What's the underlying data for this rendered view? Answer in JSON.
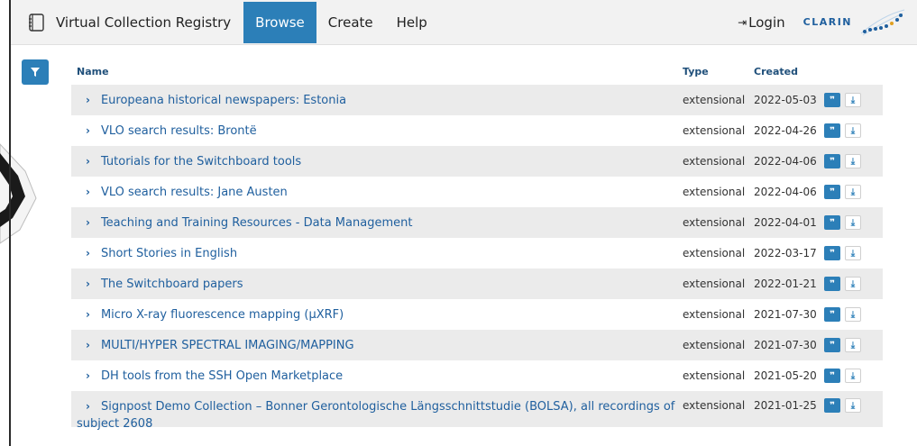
{
  "header": {
    "app_title": "Virtual Collection Registry",
    "nav": [
      {
        "label": "Browse",
        "active": true
      },
      {
        "label": "Create",
        "active": false
      },
      {
        "label": "Help",
        "active": false
      }
    ],
    "login_label": "Login",
    "brand_text": "CLARIN"
  },
  "colors": {
    "accent": "#2c7fb8",
    "link": "#1f5f9e",
    "row_alt": "#ebebeb"
  },
  "table": {
    "columns": {
      "name": "Name",
      "type": "Type",
      "created": "Created"
    },
    "rows": [
      {
        "name": "Europeana historical newspapers: Estonia",
        "type": "extensional",
        "created": "2022-05-03"
      },
      {
        "name": "VLO search results: Brontë",
        "type": "extensional",
        "created": "2022-04-26"
      },
      {
        "name": "Tutorials for the Switchboard tools",
        "type": "extensional",
        "created": "2022-04-06"
      },
      {
        "name": "VLO search results: Jane Austen",
        "type": "extensional",
        "created": "2022-04-06"
      },
      {
        "name": "Teaching and Training Resources - Data Management",
        "type": "extensional",
        "created": "2022-04-01"
      },
      {
        "name": "Short Stories in English",
        "type": "extensional",
        "created": "2022-03-17"
      },
      {
        "name": "The Switchboard papers",
        "type": "extensional",
        "created": "2022-01-21"
      },
      {
        "name": "Micro X-ray fluorescence mapping (µXRF)",
        "type": "extensional",
        "created": "2021-07-30"
      },
      {
        "name": "MULTI/HYPER SPECTRAL IMAGING/MAPPING",
        "type": "extensional",
        "created": "2021-07-30"
      },
      {
        "name": "DH tools from the SSH Open Marketplace",
        "type": "extensional",
        "created": "2021-05-20"
      },
      {
        "name": "Signpost Demo Collection – Bonner Gerontologische Längsschnittstudie (BOLSA), all recordings of subject 2608",
        "type": "extensional",
        "created": "2021-01-25"
      }
    ],
    "icons": {
      "expand": "chevron-right-icon",
      "cite": "quote-icon",
      "download": "download-icon",
      "filter": "filter-icon"
    }
  }
}
